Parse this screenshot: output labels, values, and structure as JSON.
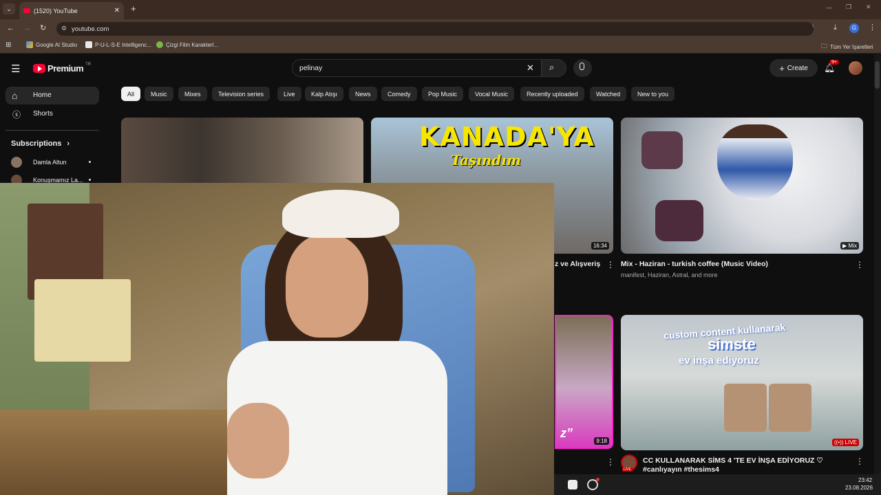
{
  "browser": {
    "tab_title": "(1520) YouTube",
    "url": "youtube.com",
    "bookmarks": [
      "Google AI Studio",
      "P-U-L-S-E Intelligenc...",
      "Çizgi Film Karakterl..."
    ],
    "all_bookmarks": "Tüm Yer İşaretleri"
  },
  "youtube": {
    "logo_text": "Premium",
    "logo_badge": "TR",
    "search_value": "pelinay",
    "create_label": "Create",
    "notif_count": "9+",
    "sidebar": {
      "home": "Home",
      "shorts": "Shorts",
      "subscriptions": "Subscriptions",
      "subs": [
        "Damla Altun",
        "Konuşmamız La..."
      ]
    },
    "chips": [
      "All",
      "Music",
      "Mixes",
      "Television series",
      "Live",
      "Kalp Atışı",
      "News",
      "Comedy",
      "Pop Music",
      "Vocal Music",
      "Recently uploaded",
      "Watched",
      "New to you"
    ],
    "videos": [
      {
        "title": "z ve Alışveriş",
        "duration": "16:34",
        "thumb_text": "KANADA'YA",
        "thumb_sub": "Taşındım"
      },
      {
        "title": "Mix - Haziran - turkish coffee (Music Video)",
        "meta": "manifest, Haziran, Astral, and more",
        "badge": "Mix"
      },
      {
        "duration": "9:18",
        "thumb_text": "z”"
      },
      {
        "title": "CC KULLANARAK SİMS 4 'TE EV İNŞA EDİYORUZ ♡ #canlıyayın #thesims4",
        "thumb_line1": "custom content kullanarak",
        "thumb_line2": "simste",
        "thumb_line3": "ev inşa ediyoruz",
        "live_badge": "LIVE",
        "avatar_badge": "LIVE"
      }
    ]
  },
  "taskbar": {
    "time": "23:42",
    "date": "23.08.2026"
  },
  "colors": {
    "chrome_bg": "#4a3a30",
    "yt_red": "#ff0033",
    "live_red": "#cc0000"
  }
}
